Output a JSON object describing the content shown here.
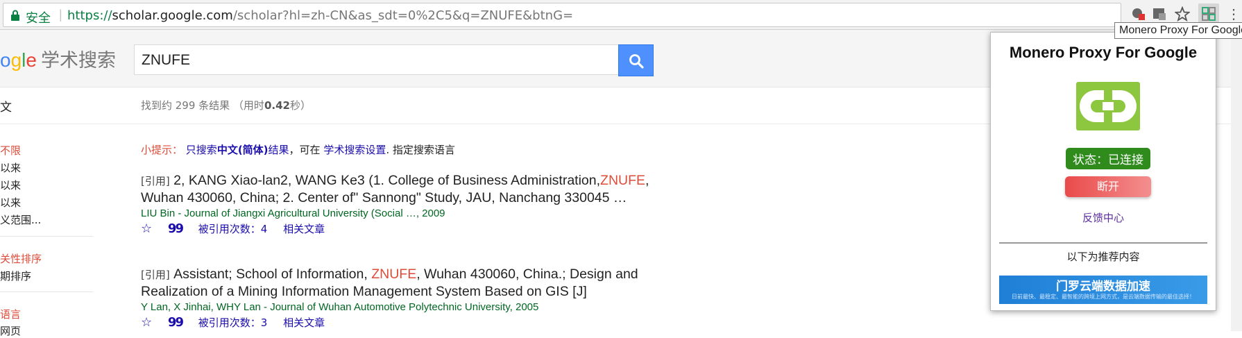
{
  "browser": {
    "secure_label": "安全",
    "url_scheme": "https://",
    "url_host": "scholar.google.com",
    "url_path": "/scholar?hl=zh-CN&as_sdt=0%2C5&q=ZNUFE&btnG=",
    "tooltip": "Monero Proxy For Google"
  },
  "header": {
    "logo_partial": "ogle",
    "scholar_label": "学术搜索",
    "search_value": "ZNUFE"
  },
  "stats": {
    "left_cut": "文",
    "prefix": "找到约 299 条结果 （用时",
    "time": "0.42",
    "suffix": "秒）"
  },
  "sidebar": {
    "time_heading": "不限",
    "time_items": [
      "以来",
      "以来",
      "以来",
      "义范围..."
    ],
    "sort_heading": "关性排序",
    "sort_items": [
      "期排序"
    ],
    "lang_heading": "语言",
    "lang_items": [
      "网页"
    ]
  },
  "tip": {
    "label": "小提示：",
    "link1_pre": "只搜索",
    "link1_bold": "中文(简体)",
    "link1_post": "结果",
    "mid": "，可在 ",
    "link2": "学术搜索设置",
    "end": ". 指定搜索语言"
  },
  "results": [
    {
      "cite_tag": "[引用]",
      "title_a": "2, KANG Xiao-lan2, WANG Ke3 (1. College of Business Administration,",
      "title_hl": "ZNUFE",
      "title_b": ", Wuhan 430060, China; 2. Center of\" Sannong\" Study, JAU, Nanchang 330045 …",
      "meta": "LIU Bin - Journal of Jiangxi Agricultural University (Social …, 2009",
      "cited_by": "被引用次数：4",
      "related": "相关文章"
    },
    {
      "cite_tag": "[引用]",
      "title_a": "Assistant; School of Information, ",
      "title_hl": "ZNUFE",
      "title_b": ", Wuhan 430060, China.; Design and Realization of a Mining Information Management System Based on GIS [J]",
      "meta": "Y Lan, X Jinhai, WHY Lan - Journal of Wuhan Automotive Polytechnic University, 2005",
      "cited_by": "被引用次数：3",
      "related": "相关文章"
    }
  ],
  "popup": {
    "title": "Monero Proxy For Google",
    "status": "状态：已连接",
    "disconnect": "断开",
    "feedback": "反馈中心",
    "recommend": "以下为推荐内容",
    "ad_title": "门罗云端数据加速",
    "ad_sub": "日前最快、最稳定、最智能的跨境上网方式，是云端数据传输的最佳选择！"
  },
  "colors": {
    "accent_blue": "#4d90fe",
    "highlight_red": "#dd4b39",
    "link": "#1a0dab",
    "meta_green": "#006621",
    "status_green": "#2e8b1c",
    "logo_green": "#8dc63f"
  },
  "icons": [
    "lock-icon",
    "search-icon",
    "star-icon",
    "quote-icon",
    "extension-icon",
    "translate-icon",
    "bookmark-star-icon",
    "menu-icon",
    "monero-proxy-logo-icon"
  ]
}
